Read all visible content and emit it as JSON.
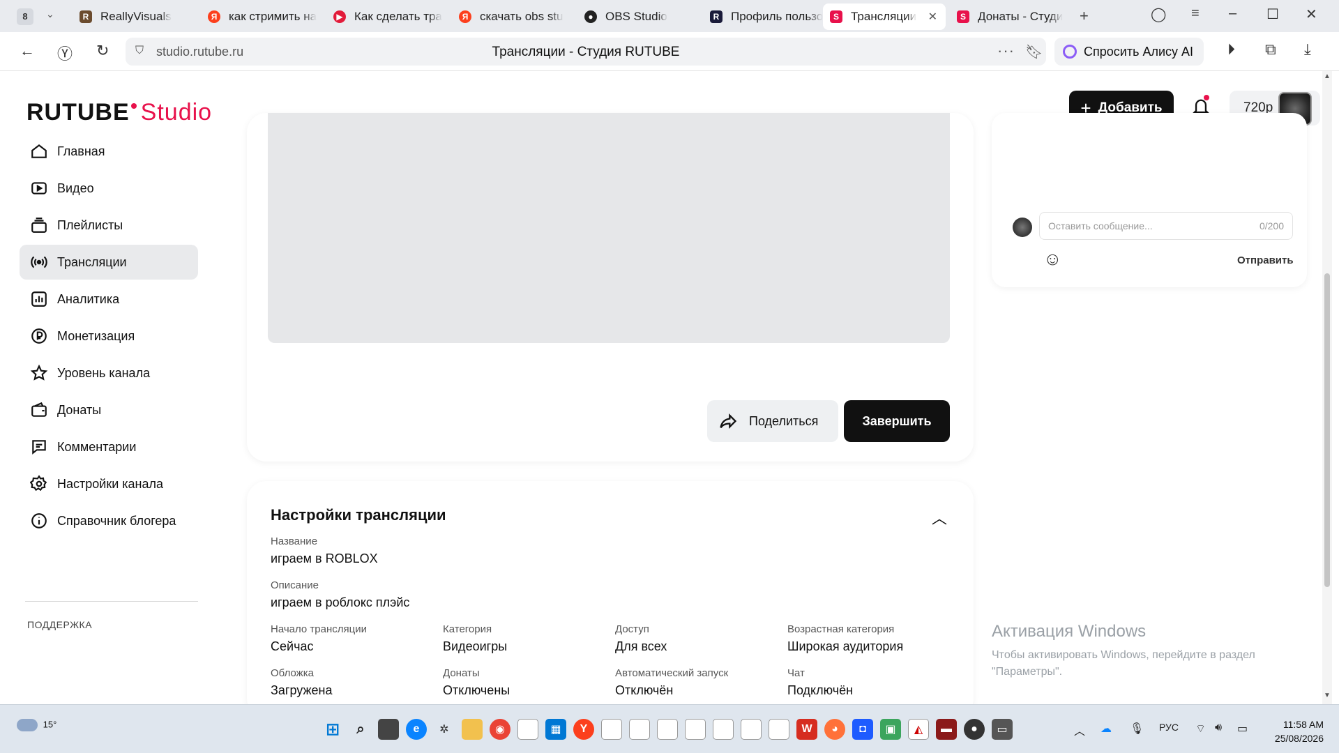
{
  "browser": {
    "tab_count": "8",
    "tabs": [
      {
        "label": "ReallyVisuals",
        "icon": "reallyvisuals-icon",
        "color": "#6b4b2e"
      },
      {
        "label": "как стримить на",
        "icon": "yandex-icon",
        "color": "#fc3f1d"
      },
      {
        "label": "Как сделать тра",
        "icon": "youtube-play-icon",
        "color": "#e21b3a"
      },
      {
        "label": "скачать obs stu",
        "icon": "yandex-icon",
        "color": "#fc3f1d"
      },
      {
        "label": "OBS Studio",
        "icon": "obs-icon",
        "color": "#222222"
      },
      {
        "label": "Профиль пользо",
        "icon": "rutube-icon",
        "color": "#1a1b3a"
      },
      {
        "label": "Трансляции",
        "icon": "rutube-studio-icon",
        "color": "#e8114b"
      },
      {
        "label": "Донаты - Студи",
        "icon": "rutube-studio-icon",
        "color": "#e8114b"
      }
    ],
    "url": "studio.rutube.ru",
    "page_title": "Трансляции - Студия RUTUBE",
    "alice_label": "Спросить Алису AI"
  },
  "header": {
    "logo_main": "RUTUBE",
    "logo_studio": "Studio",
    "add_label": "Добавить",
    "quality": "720p"
  },
  "sidebar": {
    "items": [
      {
        "label": "Главная",
        "icon": "home-icon"
      },
      {
        "label": "Видео",
        "icon": "video-icon"
      },
      {
        "label": "Плейлисты",
        "icon": "playlists-icon"
      },
      {
        "label": "Трансляции",
        "icon": "broadcast-icon",
        "active": true
      },
      {
        "label": "Аналитика",
        "icon": "analytics-icon"
      },
      {
        "label": "Монетизация",
        "icon": "monetization-icon"
      },
      {
        "label": "Уровень канала",
        "icon": "star-icon"
      },
      {
        "label": "Донаты",
        "icon": "wallet-icon"
      },
      {
        "label": "Комментарии",
        "icon": "comments-icon"
      },
      {
        "label": "Настройки канала",
        "icon": "gear-icon"
      },
      {
        "label": "Справочник блогера",
        "icon": "info-icon"
      }
    ],
    "support_label": "ПОДДЕРЖКА"
  },
  "stream": {
    "share_label": "Поделиться",
    "finish_label": "Завершить"
  },
  "chat": {
    "placeholder": "Оставить сообщение...",
    "counter": "0/200",
    "send_label": "Отправить"
  },
  "settings": {
    "title": "Настройки трансляции",
    "name_label": "Название",
    "name_value": "играем в ROBLOX",
    "description_label": "Описание",
    "description_value": "играем в роблокс плэйс",
    "grid": [
      {
        "label": "Начало трансляции",
        "value": "Сейчас"
      },
      {
        "label": "Категория",
        "value": "Видеоигры"
      },
      {
        "label": "Доступ",
        "value": "Для всех"
      },
      {
        "label": "Возрастная категория",
        "value": "Широкая аудитория"
      },
      {
        "label": "Обложка",
        "value": "Загружена"
      },
      {
        "label": "Донаты",
        "value": "Отключены"
      },
      {
        "label": "Автоматический запуск",
        "value": "Отключён"
      },
      {
        "label": "Чат",
        "value": "Подключён"
      }
    ]
  },
  "watermark": {
    "title": "Активация Windows",
    "line1": "Чтобы активировать Windows, перейдите в раздел",
    "line2": "\"Параметры\"."
  },
  "taskbar": {
    "temperature": "15°",
    "language": "РУС",
    "time": "11:58 AM",
    "date": "25/08/2026"
  },
  "colors": {
    "brand_accent": "#e8114b",
    "primary_button": "#111111",
    "active_nav_bg": "#e9eaec"
  }
}
